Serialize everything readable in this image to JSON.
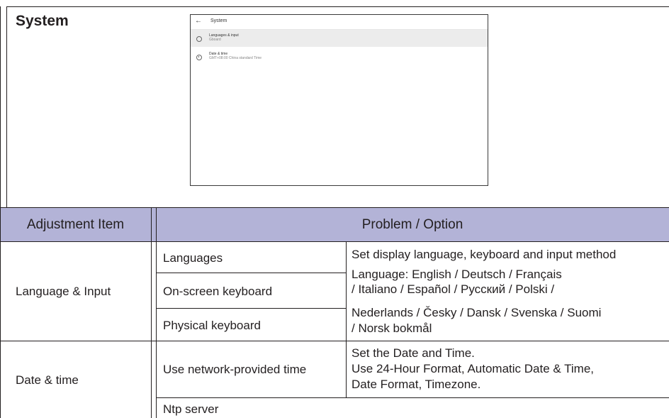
{
  "section_title": "System",
  "screenshot": {
    "header_title": "System",
    "items": [
      {
        "title": "Languages & input",
        "subtitle": "Gboard"
      },
      {
        "title": "Date & time",
        "subtitle": "GMT+08:00 China standard Time"
      }
    ]
  },
  "table": {
    "headers": {
      "adjustment_item": "Adjustment Item",
      "problem_option": "Problem / Option"
    },
    "rows": {
      "language_input": {
        "item": "Language & Input",
        "sub_items": [
          "Languages",
          "On-screen keyboard",
          "Physical keyboard"
        ],
        "description_line1": "Set display language, keyboard and input method",
        "description_lines": [
          "Language: English / Deutsch / Français",
          "/ Italiano / Español / Русский / Polski /",
          "Nederlands / Česky / Dansk / Svenska / Suomi",
          "/ Norsk bokmål"
        ]
      },
      "date_time": {
        "item": "Date & time",
        "sub_items": [
          "Use network-provided time",
          "Ntp server"
        ],
        "description_lines": [
          "Set the Date and Time.",
          "Use 24-Hour Format, Automatic Date & Time,",
          "Date Format, Timezone."
        ]
      }
    }
  }
}
